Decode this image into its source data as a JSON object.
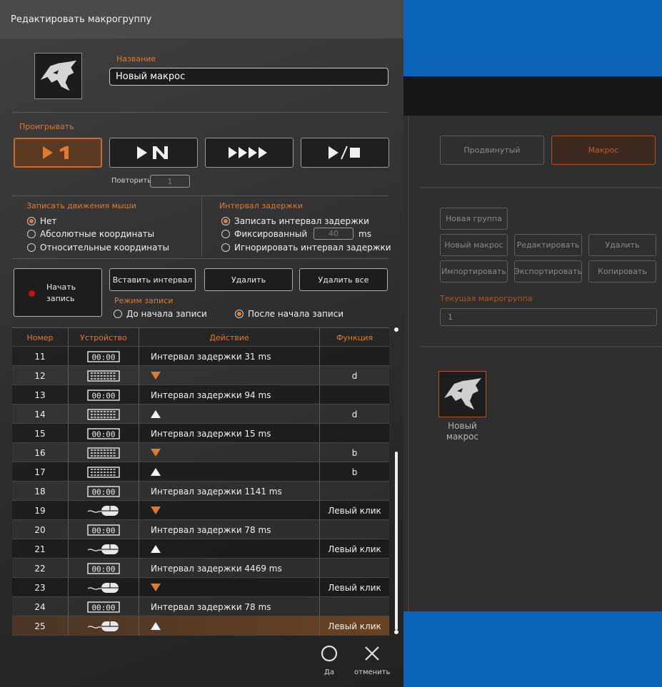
{
  "dialog": {
    "title": "Редактировать макрогруппу",
    "name_label": "Название",
    "name_value": "Новый макрос",
    "play_label": "Проигрывать",
    "play_modes": [
      "play-once-icon",
      "play-n-times-icon",
      "play-loop-icon",
      "play-stop-icon"
    ],
    "repeat_label": "Повторить",
    "repeat_value": "1",
    "mouse_group": {
      "title": "Записать движения мыши",
      "options": [
        "Нет",
        "Абсолютные координаты",
        "Относительные координаты"
      ],
      "selected": 0
    },
    "delay_group": {
      "title": "Интервал задержки",
      "options": [
        "Записать интервал задержки",
        "Фиксированный",
        "Игнорировать интервал задержки"
      ],
      "selected": 0,
      "fixed_value": "40",
      "fixed_unit": "ms"
    },
    "record_button": "Начать запись",
    "insert_interval": "Вставить интервал",
    "delete": "Удалить",
    "delete_all": "Удалить все",
    "mode_group": {
      "title": "Режим записи",
      "options": [
        "До начала записи",
        "После начала записи"
      ],
      "selected": 1
    },
    "table": {
      "headers": [
        "Номер",
        "Устройство",
        "Действие",
        "Функция"
      ],
      "rows": [
        {
          "num": "11",
          "device": "timer",
          "action": "Интервал задержки 31 ms",
          "arrow": "",
          "func": ""
        },
        {
          "num": "12",
          "device": "keyboard",
          "action": "",
          "arrow": "down",
          "func": "d"
        },
        {
          "num": "13",
          "device": "timer",
          "action": "Интервал задержки 94 ms",
          "arrow": "",
          "func": ""
        },
        {
          "num": "14",
          "device": "keyboard",
          "action": "",
          "arrow": "up",
          "func": "d"
        },
        {
          "num": "15",
          "device": "timer",
          "action": "Интервал задержки 15 ms",
          "arrow": "",
          "func": ""
        },
        {
          "num": "16",
          "device": "keyboard",
          "action": "",
          "arrow": "down",
          "func": "b"
        },
        {
          "num": "17",
          "device": "keyboard",
          "action": "",
          "arrow": "up",
          "func": "b"
        },
        {
          "num": "18",
          "device": "timer",
          "action": "Интервал задержки 1141 ms",
          "arrow": "",
          "func": ""
        },
        {
          "num": "19",
          "device": "mouse",
          "action": "",
          "arrow": "down",
          "func": "Левый клик"
        },
        {
          "num": "20",
          "device": "timer",
          "action": "Интервал задержки 78 ms",
          "arrow": "",
          "func": ""
        },
        {
          "num": "21",
          "device": "mouse",
          "action": "",
          "arrow": "up",
          "func": "Левый клик"
        },
        {
          "num": "22",
          "device": "timer",
          "action": "Интервал задержки 4469 ms",
          "arrow": "",
          "func": ""
        },
        {
          "num": "23",
          "device": "mouse",
          "action": "",
          "arrow": "down",
          "func": "Левый клик"
        },
        {
          "num": "24",
          "device": "timer",
          "action": "Интервал задержки 78 ms",
          "arrow": "",
          "func": ""
        },
        {
          "num": "25",
          "device": "mouse",
          "action": "",
          "arrow": "up",
          "func": "Левый клик"
        }
      ],
      "selected_row": "25",
      "timer_text": "00:00"
    },
    "ok_label": "Да",
    "cancel_label": "отменить"
  },
  "background": {
    "tabs": [
      "Продвинутый",
      "Макрос"
    ],
    "active_tab": "Макрос",
    "buttons": [
      "Новая группа",
      "Новый макрос",
      "Редактировать",
      "Удалить",
      "Импортировать",
      "Экспортировать",
      "Копировать"
    ],
    "current_group_label": "Текущая макрогруппа",
    "current_group_value": "1",
    "macro_name": "Новый макрос"
  },
  "colors": {
    "accent": "#e07a2f",
    "brand_blue": "#0b64b8",
    "record_red": "#c81010"
  }
}
